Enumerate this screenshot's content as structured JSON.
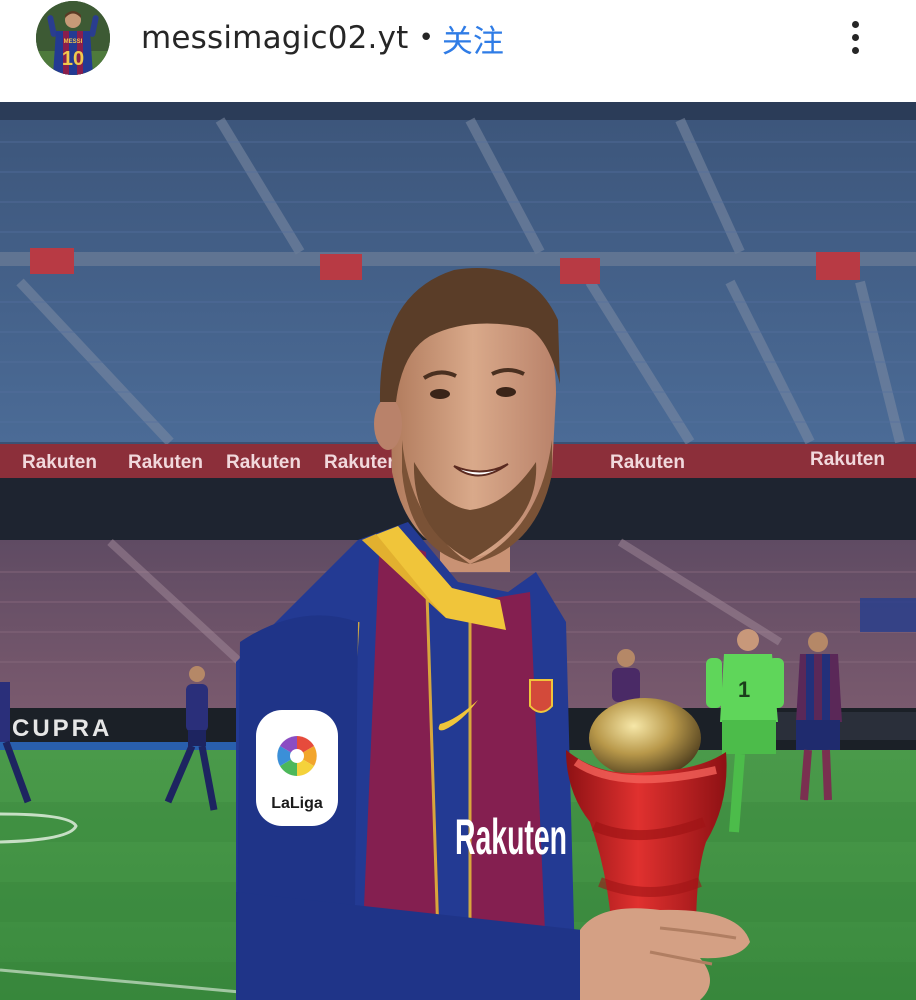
{
  "post": {
    "username": "messimagic02.yt",
    "separator": "•",
    "follow_label": "关注",
    "avatar_jersey_number": "10",
    "avatar_jersey_text": "MESSI"
  },
  "photo": {
    "board_sponsor": "Rakuten",
    "ad_board_text": "CUPRA",
    "shirt_sponsor": "Rakuten",
    "sleeve_badge": "LaLiga",
    "keeper_number": "1",
    "colors": {
      "follow": "#2f7ce6",
      "seats": "#3b5275",
      "pitch": "#3f9a45",
      "shirt_blue": "#233a93",
      "shirt_red": "#8a1e4c",
      "trophy": "#d21f23"
    }
  }
}
